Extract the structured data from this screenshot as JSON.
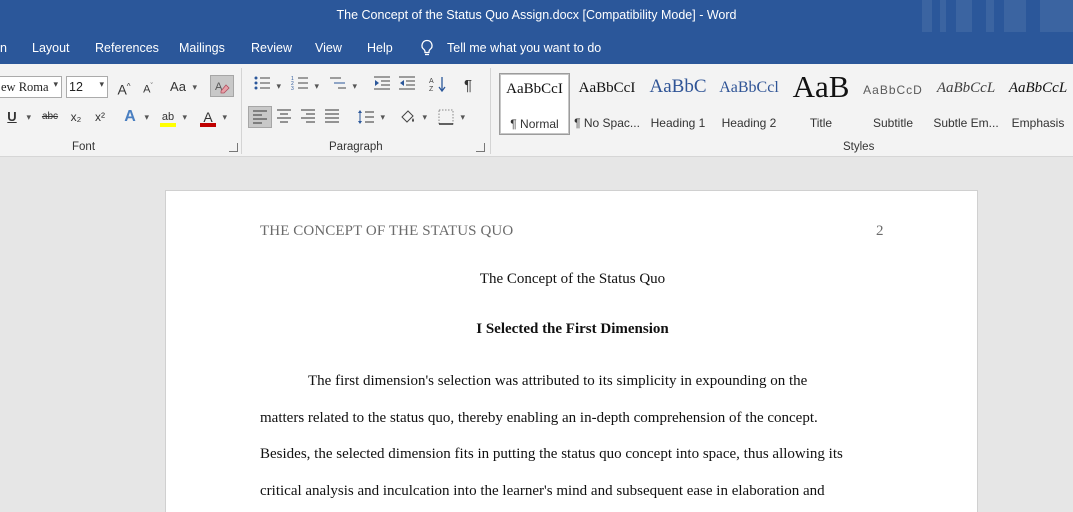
{
  "window": {
    "title": "The Concept of the Status Quo Assign.docx [Compatibility Mode]  -  Word"
  },
  "menu": {
    "tabs": [
      "n",
      "Layout",
      "References",
      "Mailings",
      "Review",
      "View",
      "Help"
    ],
    "tell_me": "Tell me what you want to do"
  },
  "ribbon": {
    "font": {
      "family": "ew Roma",
      "size": "12",
      "grow_glyph": "A",
      "shrink_glyph": "A",
      "case_glyph": "Aa",
      "underline_glyph": "U",
      "strike_glyph": "abc",
      "subscript_glyph": "x₂",
      "superscript_glyph": "x²",
      "effects_glyph": "A",
      "highlight_glyph": "ab",
      "color_glyph": "A",
      "group_label": "Font"
    },
    "paragraph": {
      "pilcrow_glyph": "¶",
      "group_label": "Paragraph"
    },
    "styles": {
      "group_label": "Styles",
      "items": [
        {
          "preview": "AaBbCcI",
          "name": "¶ Normal"
        },
        {
          "preview": "AaBbCcI",
          "name": "¶ No Spac..."
        },
        {
          "preview": "AaBbC",
          "name": "Heading 1"
        },
        {
          "preview": "AaBbCcl",
          "name": "Heading 2"
        },
        {
          "preview": "AaB",
          "name": "Title"
        },
        {
          "preview": "AaBbCcD",
          "name": "Subtitle"
        },
        {
          "preview": "AaBbCcL",
          "name": "Subtle Em..."
        },
        {
          "preview": "AaBbCcL",
          "name": "Emphasis"
        }
      ]
    }
  },
  "document": {
    "running_head": "THE CONCEPT OF THE STATUS QUO",
    "page_number": "2",
    "title": "The Concept of the Status Quo",
    "heading": "I Selected the First Dimension",
    "lines": [
      "The first dimension's selection was attributed to its simplicity in expounding on the",
      "matters related to the status quo, thereby enabling an in-depth comprehension of the concept.",
      "Besides, the selected dimension fits in putting the status quo concept into space, thus allowing its",
      "critical analysis and inculcation into the learner's mind and subsequent ease in elaboration and"
    ]
  },
  "colors": {
    "brand": "#2b579a",
    "ribbon": "#f3f3f3",
    "canvas": "#e6e6e6",
    "heading_style": "#2f5496",
    "font_color_bar": "#c00000",
    "highlight_bar": "#ffff00"
  }
}
